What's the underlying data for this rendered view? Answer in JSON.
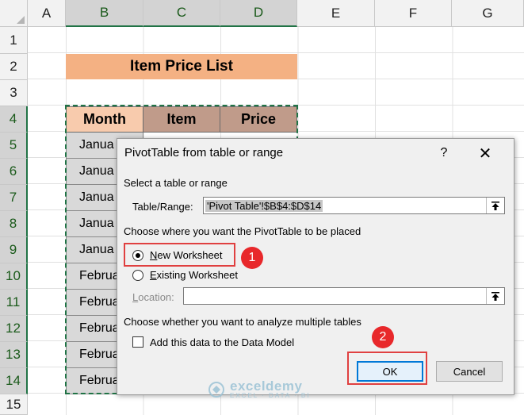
{
  "spreadsheet": {
    "columns": [
      "A",
      "B",
      "C",
      "D",
      "E",
      "F",
      "G"
    ],
    "rows": [
      "1",
      "2",
      "3",
      "4",
      "5",
      "6",
      "7",
      "8",
      "9",
      "10",
      "11",
      "12",
      "13",
      "14",
      "15"
    ],
    "title": "Item Price List",
    "table_headers": [
      "Month",
      "Item",
      "Price"
    ],
    "month_cells": [
      "Janua",
      "Janua",
      "Janua",
      "Janua",
      "Janua",
      "Februa",
      "Februa",
      "Februa",
      "Februa",
      "Februa"
    ],
    "colors": {
      "title_fill": "#f4b183",
      "header_month": "#f8cbad",
      "header_other": "#c09b8a",
      "data_fill": "#d9d9d9",
      "selection": "#217346"
    }
  },
  "dialog": {
    "title": "PivotTable from table or range",
    "help_label": "?",
    "close_label": "✕",
    "section1": "Select a table or range",
    "table_range_label": "Table/Range:",
    "table_range_value": "'Pivot Table'!$B$4:$D$14",
    "section2": "Choose where you want the PivotTable to be placed",
    "new_ws_first": "N",
    "new_ws_rest": "ew Worksheet",
    "existing_ws_first": "E",
    "existing_ws_rest": "xisting Worksheet",
    "location_first": "L",
    "location_rest": "ocation:",
    "location_value": "",
    "section3": "Choose whether you want to analyze multiple tables",
    "data_model_label": "Add this data to the Data Model",
    "ok_label": "OK",
    "cancel_label": "Cancel"
  },
  "annotations": {
    "step1": "1",
    "step2": "2",
    "accent": "#e8282b"
  },
  "watermark": {
    "name": "exceldemy",
    "tagline": "EXCEL · DATA · BI"
  }
}
